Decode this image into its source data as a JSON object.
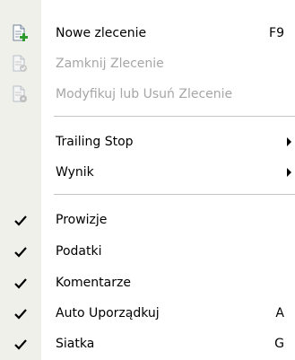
{
  "menu": {
    "items": [
      {
        "label": "Nowe zlecenie",
        "shortcut": "F9",
        "icon": "new-order-icon",
        "enabled": true
      },
      {
        "label": "Zamknij Zlecenie",
        "icon": "close-order-icon",
        "enabled": false
      },
      {
        "label": "Modyfikuj lub Usuń Zlecenie",
        "icon": "modify-order-icon",
        "enabled": false
      },
      {
        "label": "Trailing Stop",
        "submenu": true,
        "enabled": true
      },
      {
        "label": "Wynik",
        "submenu": true,
        "enabled": true
      },
      {
        "label": "Prowizje",
        "checked": true,
        "enabled": true
      },
      {
        "label": "Podatki",
        "checked": true,
        "enabled": true
      },
      {
        "label": "Komentarze",
        "checked": true,
        "enabled": true
      },
      {
        "label": "Auto Uporządkuj",
        "shortcut": "A",
        "checked": true,
        "enabled": true
      },
      {
        "label": "Siatka",
        "shortcut": "G",
        "checked": true,
        "enabled": true
      }
    ]
  },
  "colors": {
    "gutter": "#f0f0ea",
    "disabled_text": "#a6a6a6",
    "icon_green": "#2f9b2f"
  }
}
